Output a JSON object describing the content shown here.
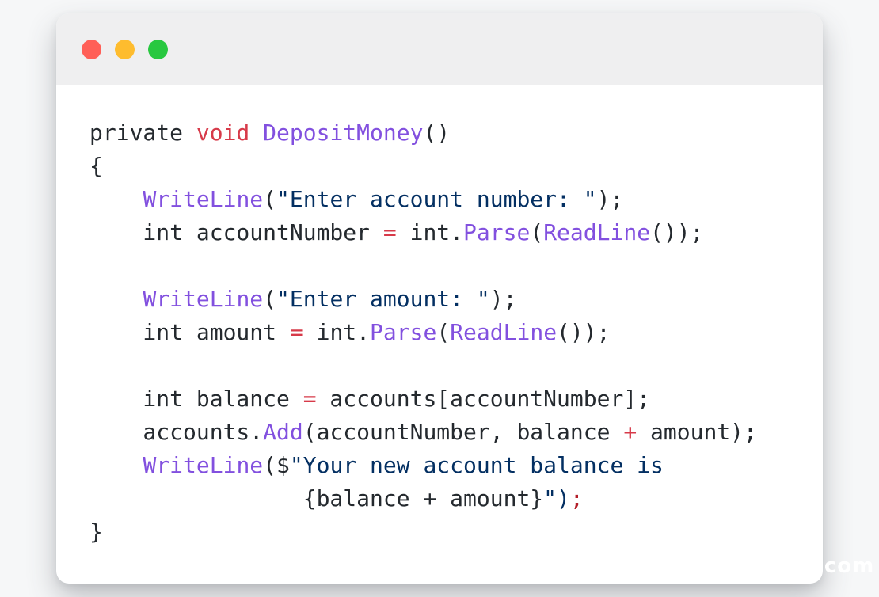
{
  "window": {
    "controls": [
      {
        "name": "close",
        "color": "#ff5f57"
      },
      {
        "name": "minimize",
        "color": "#febc2e"
      },
      {
        "name": "zoom",
        "color": "#28c840"
      }
    ]
  },
  "colors": {
    "plain": "#24292e",
    "keyword": "#d73a49",
    "function": "#8250df",
    "string": "#032f62"
  },
  "code": {
    "lines": [
      [
        {
          "t": "private ",
          "c": "plain"
        },
        {
          "t": "void",
          "c": "keyword"
        },
        {
          "t": " ",
          "c": "plain"
        },
        {
          "t": "DepositMoney",
          "c": "func"
        },
        {
          "t": "()",
          "c": "plain"
        }
      ],
      [
        {
          "t": "{",
          "c": "plain"
        }
      ],
      [
        {
          "t": "    ",
          "c": "plain"
        },
        {
          "t": "WriteLine",
          "c": "func"
        },
        {
          "t": "(",
          "c": "plain"
        },
        {
          "t": "\"Enter account number: \"",
          "c": "string"
        },
        {
          "t": ");",
          "c": "plain"
        }
      ],
      [
        {
          "t": "    int accountNumber ",
          "c": "plain"
        },
        {
          "t": "=",
          "c": "op"
        },
        {
          "t": " int.",
          "c": "plain"
        },
        {
          "t": "Parse",
          "c": "func"
        },
        {
          "t": "(",
          "c": "plain"
        },
        {
          "t": "ReadLine",
          "c": "func"
        },
        {
          "t": "());",
          "c": "plain"
        }
      ],
      [],
      [
        {
          "t": "    ",
          "c": "plain"
        },
        {
          "t": "WriteLine",
          "c": "func"
        },
        {
          "t": "(",
          "c": "plain"
        },
        {
          "t": "\"Enter amount: \"",
          "c": "string"
        },
        {
          "t": ");",
          "c": "plain"
        }
      ],
      [
        {
          "t": "    int amount ",
          "c": "plain"
        },
        {
          "t": "=",
          "c": "op"
        },
        {
          "t": " int.",
          "c": "plain"
        },
        {
          "t": "Parse",
          "c": "func"
        },
        {
          "t": "(",
          "c": "plain"
        },
        {
          "t": "ReadLine",
          "c": "func"
        },
        {
          "t": "());",
          "c": "plain"
        }
      ],
      [],
      [
        {
          "t": "    int balance ",
          "c": "plain"
        },
        {
          "t": "=",
          "c": "op"
        },
        {
          "t": " accounts[accountNumber];",
          "c": "plain"
        }
      ],
      [
        {
          "t": "    accounts.",
          "c": "plain"
        },
        {
          "t": "Add",
          "c": "func"
        },
        {
          "t": "(accountNumber, balance ",
          "c": "plain"
        },
        {
          "t": "+",
          "c": "op"
        },
        {
          "t": " amount);",
          "c": "plain"
        }
      ],
      [
        {
          "t": "    ",
          "c": "plain"
        },
        {
          "t": "WriteLine",
          "c": "func"
        },
        {
          "t": "($",
          "c": "plain"
        },
        {
          "t": "\"Your new account balance is",
          "c": "string"
        }
      ],
      [
        {
          "t": "                {balance + amount}",
          "c": "plain"
        },
        {
          "t": "\")",
          "c": "string"
        },
        {
          "t": ";",
          "c": "semi-red"
        }
      ],
      [
        {
          "t": "}",
          "c": "plain"
        }
      ]
    ]
  },
  "watermark": ".com"
}
